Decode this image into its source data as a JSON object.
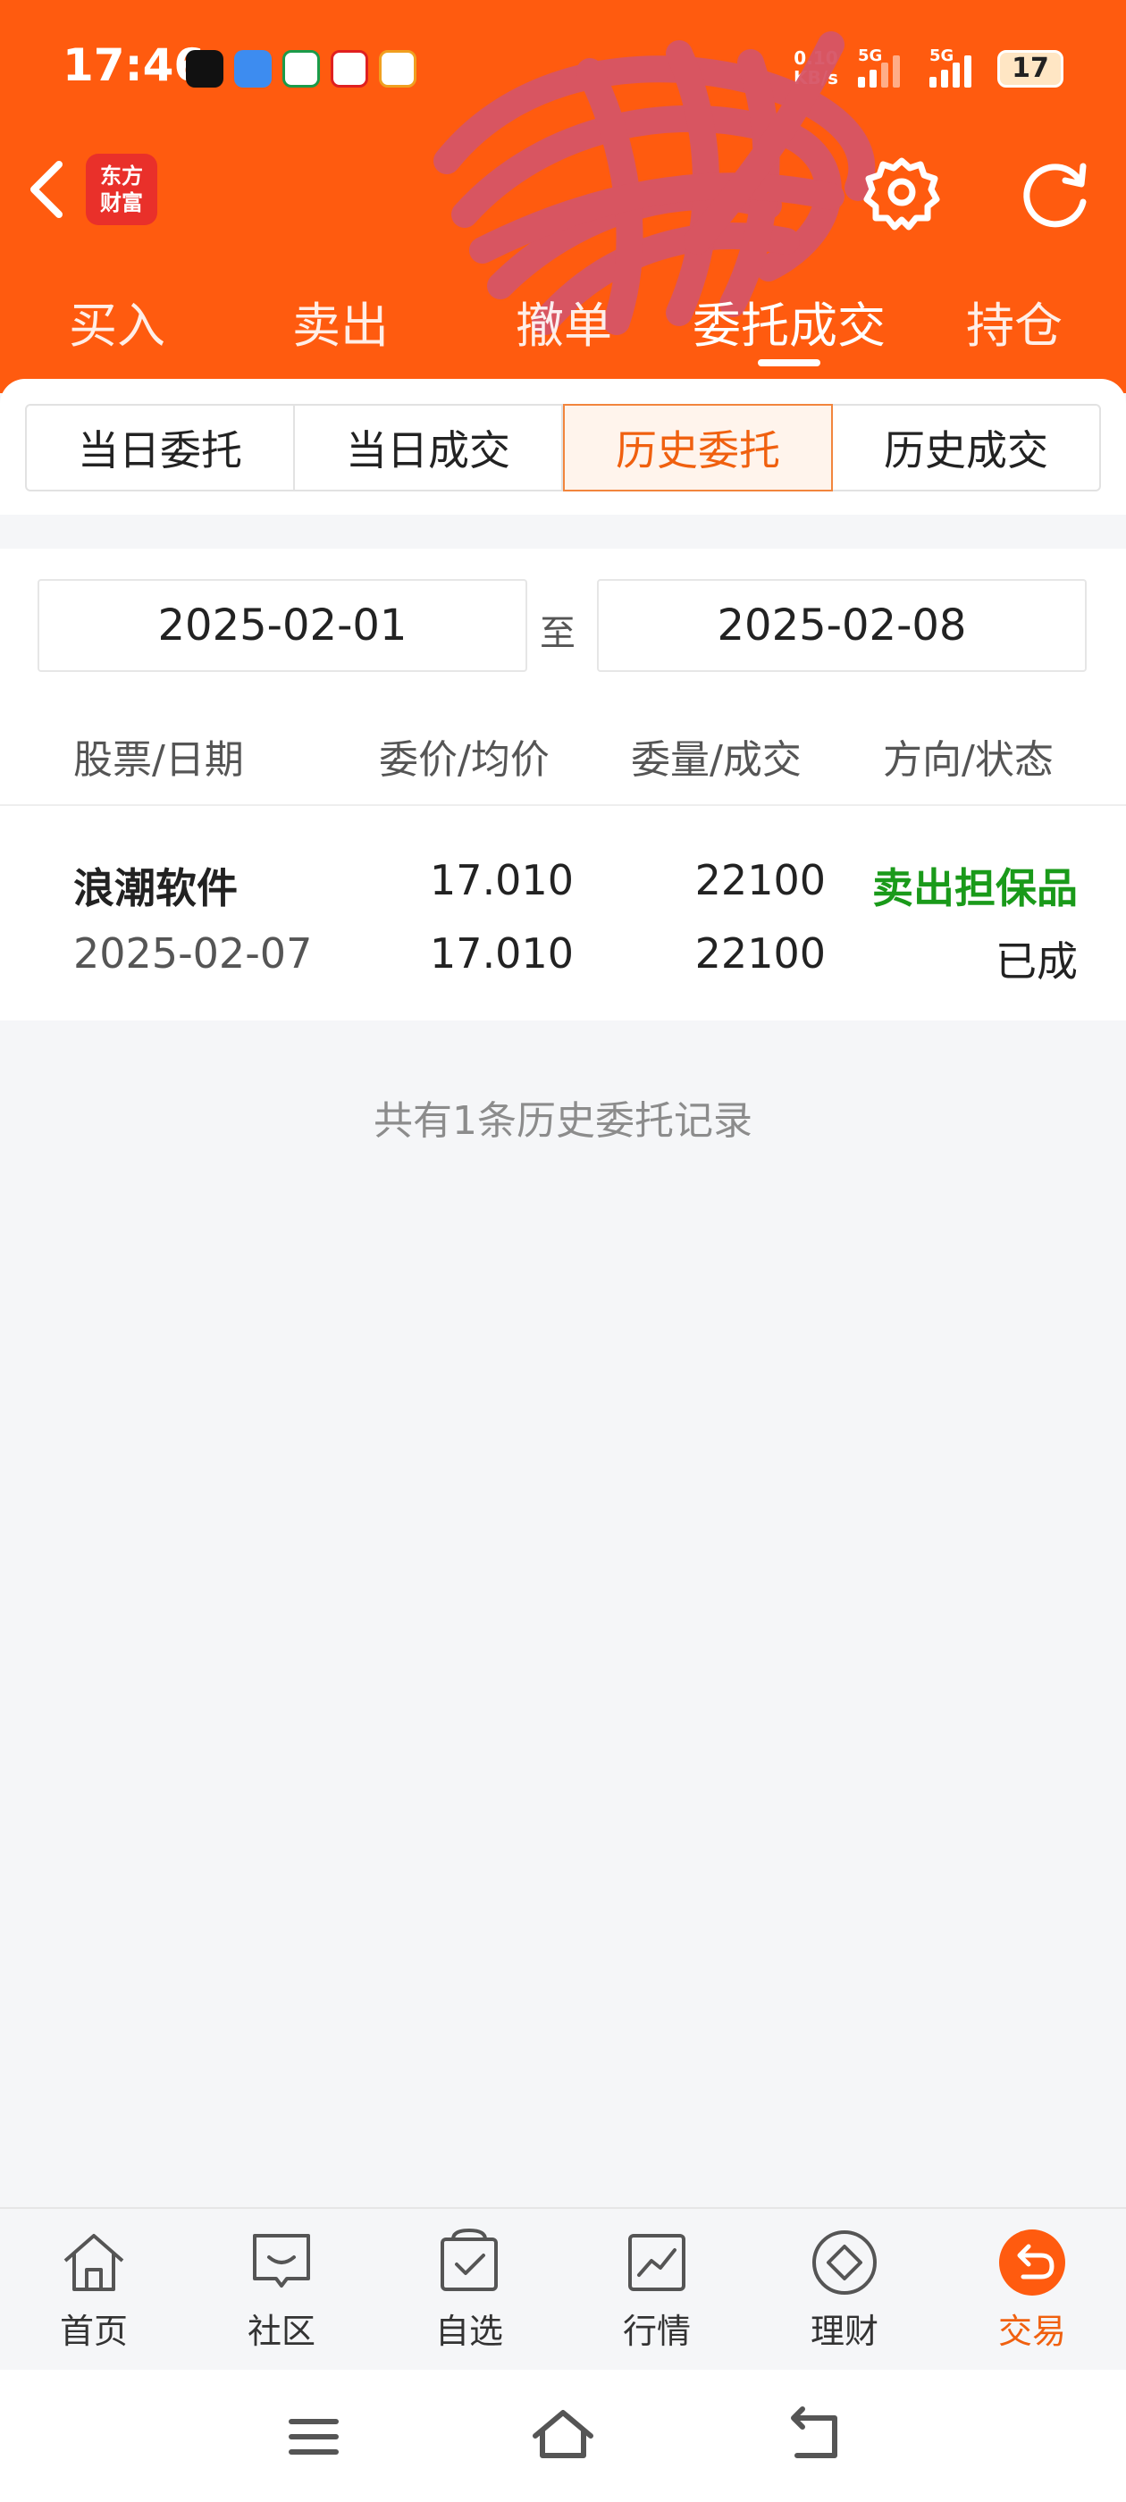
{
  "status_bar": {
    "time": "17:46",
    "net_speed_value": "0.10",
    "net_speed_unit": "KB/s",
    "network_1": "5G",
    "network_2": "5G",
    "battery": "17"
  },
  "header": {
    "logo_line1": "东方",
    "logo_line2": "财富",
    "accent_color": "#ff5b0f",
    "tabs": [
      {
        "label": "买入"
      },
      {
        "label": "卖出"
      },
      {
        "label": "撤单"
      },
      {
        "label": "委托成交"
      },
      {
        "label": "持仓"
      }
    ],
    "active_tab": "委托成交"
  },
  "segments": {
    "items": [
      {
        "label": "当日委托"
      },
      {
        "label": "当日成交"
      },
      {
        "label": "历史委托"
      },
      {
        "label": "历史成交"
      }
    ],
    "active": "历史委托"
  },
  "filter": {
    "start_date": "2025-02-01",
    "separator": "至",
    "end_date": "2025-02-08"
  },
  "table": {
    "headers": [
      "股票/日期",
      "委价/均价",
      "委量/成交",
      "方向/状态"
    ],
    "rows": [
      {
        "stock": "浪潮软件",
        "date": "2025-02-07",
        "order_price": "17.010",
        "avg_price": "17.010",
        "order_qty": "22100",
        "filled_qty": "22100",
        "direction": "卖出担保品",
        "status": "已成"
      }
    ]
  },
  "summary": "共有1条历史委托记录",
  "bottom_nav": {
    "items": [
      {
        "label": "首页",
        "icon": "home-icon"
      },
      {
        "label": "社区",
        "icon": "community-icon"
      },
      {
        "label": "自选",
        "icon": "watchlist-icon"
      },
      {
        "label": "行情",
        "icon": "market-icon"
      },
      {
        "label": "理财",
        "icon": "wealth-icon"
      },
      {
        "label": "交易",
        "icon": "trade-icon"
      }
    ],
    "active": "交易"
  }
}
